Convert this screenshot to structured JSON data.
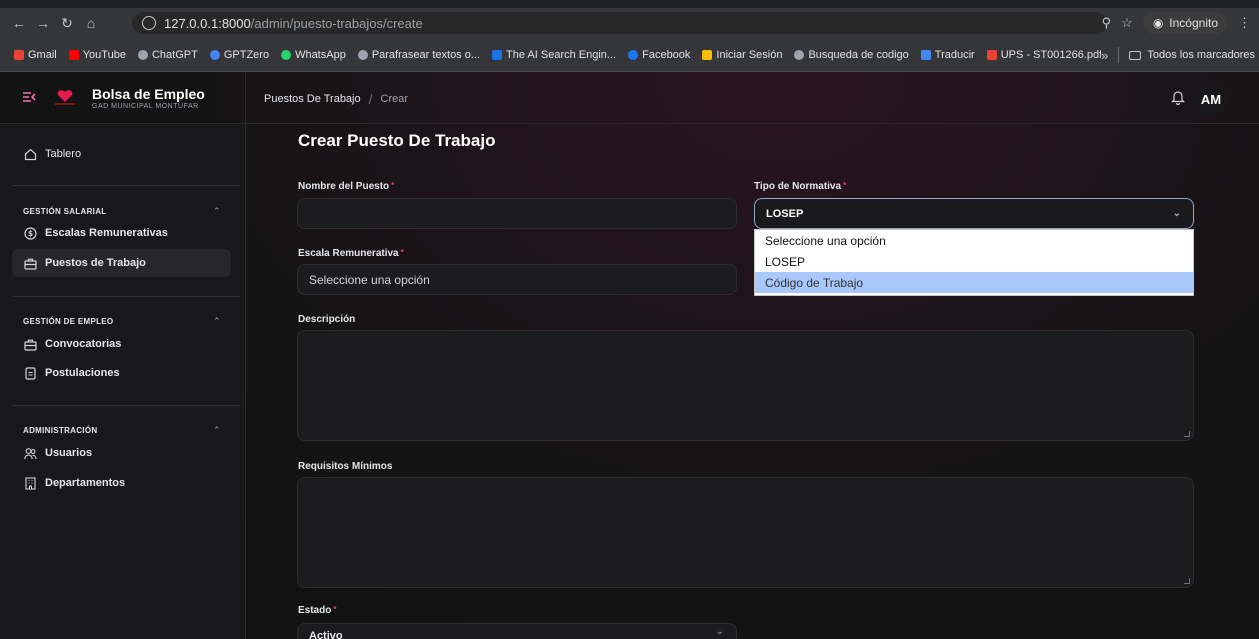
{
  "browser": {
    "url_host": "127.0.0.1:8000",
    "url_path": "/admin/puesto-trabajos/create",
    "incognito_label": "Incógnito",
    "bookmarks": [
      {
        "label": "Gmail",
        "color": "#ea4335"
      },
      {
        "label": "YouTube",
        "color": "#ff0000"
      },
      {
        "label": "ChatGPT",
        "color": "#9ca3af"
      },
      {
        "label": "GPTZero",
        "color": "#4285f4"
      },
      {
        "label": "WhatsApp",
        "color": "#25d366"
      },
      {
        "label": "Parafrasear textos o...",
        "color": "#9ca3af"
      },
      {
        "label": "The AI Search Engin...",
        "color": "#1a73e8"
      },
      {
        "label": "Facebook",
        "color": "#1877f2"
      },
      {
        "label": "Iniciar Sesión",
        "color": "#fbbc04"
      },
      {
        "label": "Busqueda de codigo",
        "color": "#9ca3af"
      },
      {
        "label": "Traducir",
        "color": "#4285f4"
      },
      {
        "label": "UPS - ST001266.pdf",
        "color": "#ea4335"
      }
    ],
    "all_bookmarks_label": "Todos los marcadores",
    "more_label": "»"
  },
  "app": {
    "brand_title": "Bolsa de Empleo",
    "brand_subtitle": "GAD MUNICIPAL MONTÚFAR",
    "accent_color": "#f472b6",
    "breadcrumb_parent": "Puestos De Trabajo",
    "breadcrumb_current": "Crear",
    "breadcrumb_separator": "/",
    "avatar_initials": "AM"
  },
  "sidebar": {
    "dashboard": "Tablero",
    "sections": [
      {
        "title": "GESTIÓN SALARIAL",
        "items": [
          "Escalas Remunerativas",
          "Puestos de Trabajo"
        ]
      },
      {
        "title": "GESTIÓN DE EMPLEO",
        "items": [
          "Convocatorias",
          "Postulaciones"
        ]
      },
      {
        "title": "ADMINISTRACIÓN",
        "items": [
          "Usuarios",
          "Departamentos"
        ]
      }
    ],
    "active_item": "Puestos de Trabajo"
  },
  "form": {
    "title": "Crear Puesto De Trabajo",
    "required_mark": "*",
    "nombre_label": "Nombre del Puesto",
    "nombre_value": "",
    "normativa_label": "Tipo de Normativa",
    "normativa_value": "LOSEP",
    "normativa_options": [
      "Seleccione una opción",
      "LOSEP",
      "Código de Trabajo"
    ],
    "normativa_highlighted": "Código de Trabajo",
    "escala_label": "Escala Remunerativa",
    "escala_placeholder": "Seleccione una opción",
    "descripcion_label": "Descripción",
    "requisitos_label": "Requisitos Mínimos",
    "estado_label": "Estado",
    "estado_value": "Activo"
  }
}
